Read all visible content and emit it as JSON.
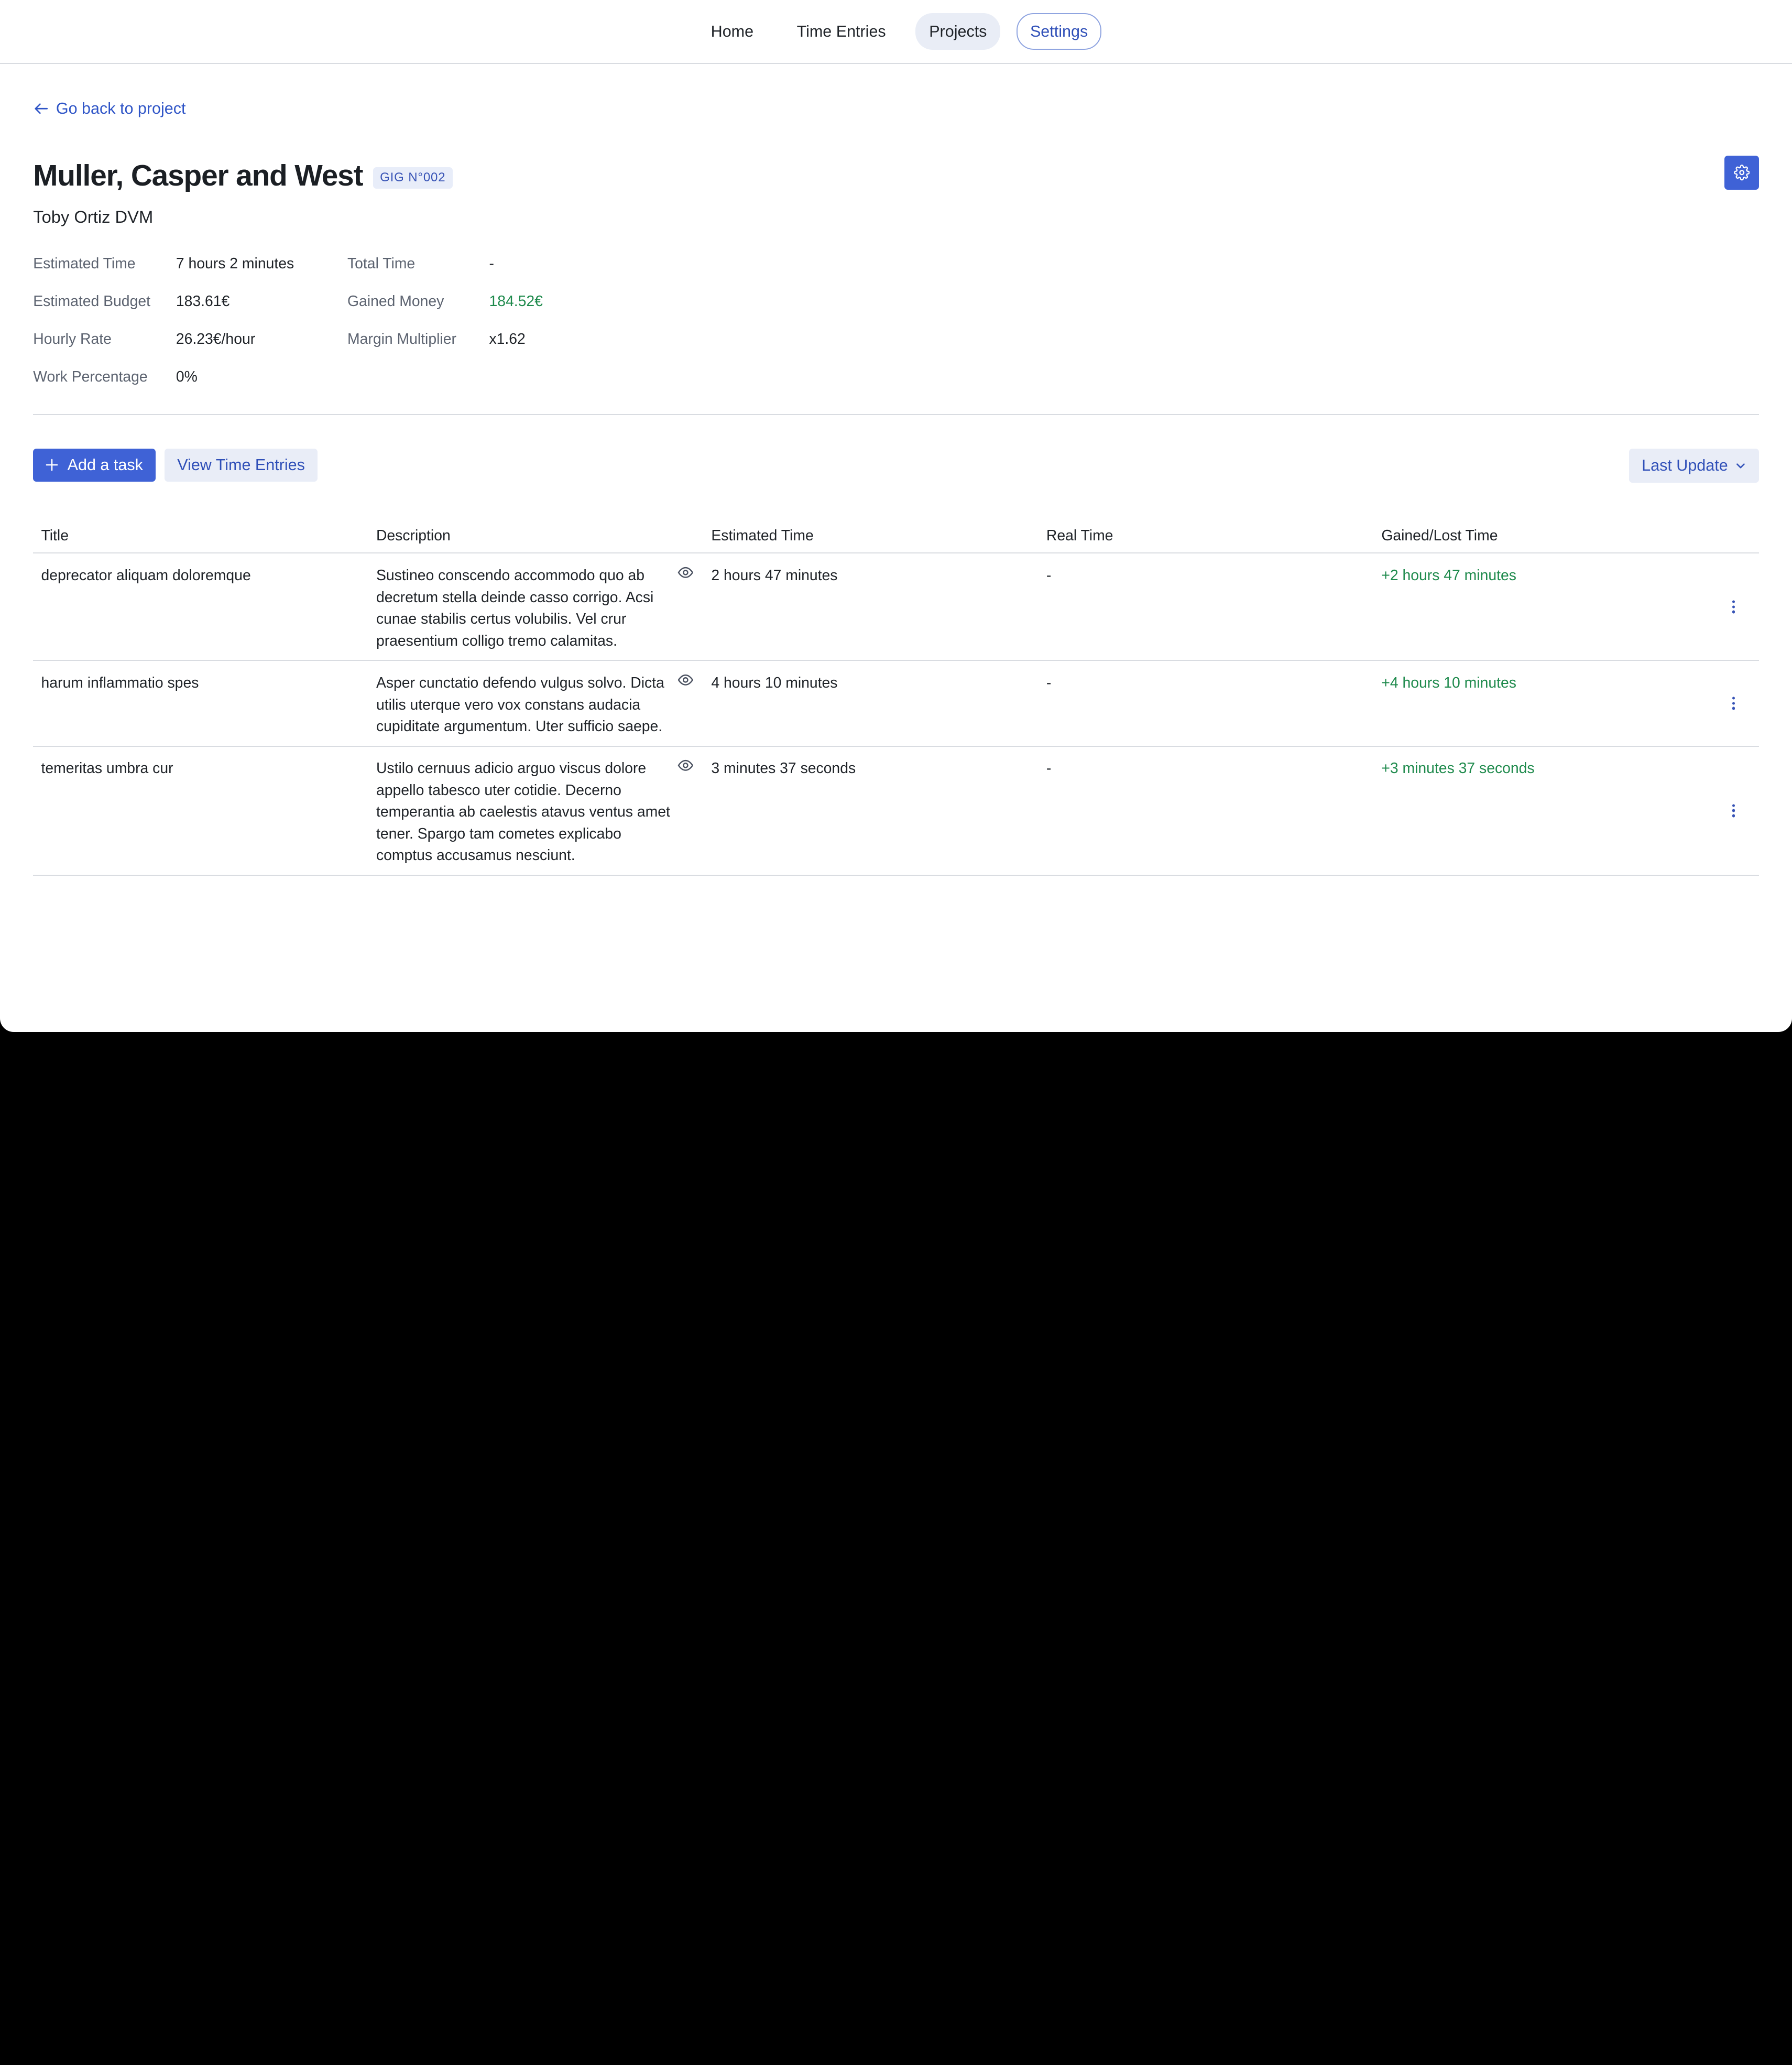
{
  "nav": {
    "items": [
      {
        "label": "Home"
      },
      {
        "label": "Time Entries"
      },
      {
        "label": "Projects"
      },
      {
        "label": "Settings"
      }
    ]
  },
  "back_link": "Go back to project",
  "project": {
    "title": "Muller, Casper and West",
    "badge": "GIG N°002",
    "client": "Toby Ortiz DVM"
  },
  "stats": {
    "estimated_time": {
      "label": "Estimated Time",
      "value": "7 hours 2 minutes"
    },
    "total_time": {
      "label": "Total Time",
      "value": "-"
    },
    "estimated_budget": {
      "label": "Estimated Budget",
      "value": "183.61€"
    },
    "gained_money": {
      "label": "Gained Money",
      "value": "184.52€"
    },
    "hourly_rate": {
      "label": "Hourly Rate",
      "value": "26.23€/hour"
    },
    "margin_multiplier": {
      "label": "Margin Multiplier",
      "value": "x1.62"
    },
    "work_percentage": {
      "label": "Work Percentage",
      "value": "0%"
    }
  },
  "toolbar": {
    "add_task": "Add a task",
    "view_time_entries": "View Time Entries",
    "sort": "Last Update"
  },
  "table": {
    "headers": {
      "title": "Title",
      "description": "Description",
      "estimated_time": "Estimated Time",
      "real_time": "Real Time",
      "gained_lost_time": "Gained/Lost Time"
    },
    "rows": [
      {
        "title": "deprecator aliquam doloremque",
        "description": "Sustineo conscendo accommodo quo ab decretum stella deinde casso corrigo. Acsi cunae stabilis certus volubilis. Vel crur praesentium colligo tremo calamitas.",
        "estimated_time": "2 hours 47 minutes",
        "real_time": "-",
        "gained_lost_time": "+2 hours 47 minutes"
      },
      {
        "title": "harum inflammatio spes",
        "description": "Asper cunctatio defendo vulgus solvo. Dicta utilis uterque vero vox constans audacia cupiditate argumentum. Uter sufficio saepe.",
        "estimated_time": "4 hours 10 minutes",
        "real_time": "-",
        "gained_lost_time": "+4 hours 10 minutes"
      },
      {
        "title": "temeritas umbra cur",
        "description": "Ustilo cernuus adicio arguo viscus dolore appello tabesco uter cotidie. Decerno temperantia ab caelestis atavus ventus amet tener. Spargo tam cometes explicabo comptus accusamus nesciunt.",
        "estimated_time": "3 minutes 37 seconds",
        "real_time": "-",
        "gained_lost_time": "+3 minutes 37 seconds"
      }
    ]
  },
  "colors": {
    "accent": "#3f62d6",
    "link": "#2f55c7",
    "positive": "#1e8a4c"
  }
}
